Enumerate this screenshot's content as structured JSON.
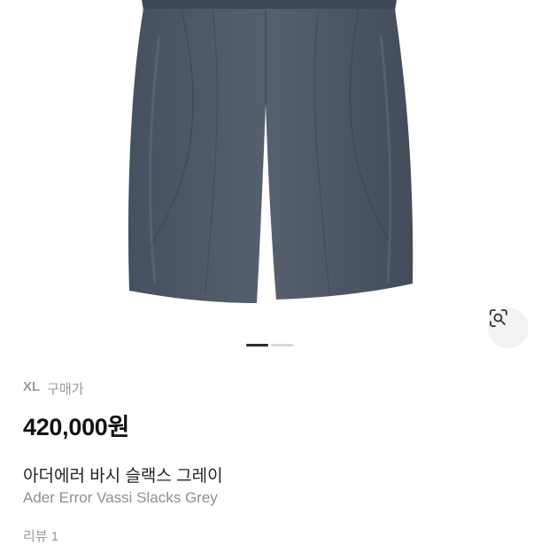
{
  "product": {
    "size": "XL",
    "purchase_price_label": "구매가",
    "price": "420,000원",
    "title_ko": "아더에러 바시 슬랙스 그레이",
    "title_en": "Ader Error Vassi Slacks Grey",
    "reviews": "리뷰 1"
  },
  "gallery": {
    "current_index": 1,
    "total": 2,
    "product_color": "#4f5966"
  },
  "icons": {
    "lens": "lens-search-icon"
  }
}
